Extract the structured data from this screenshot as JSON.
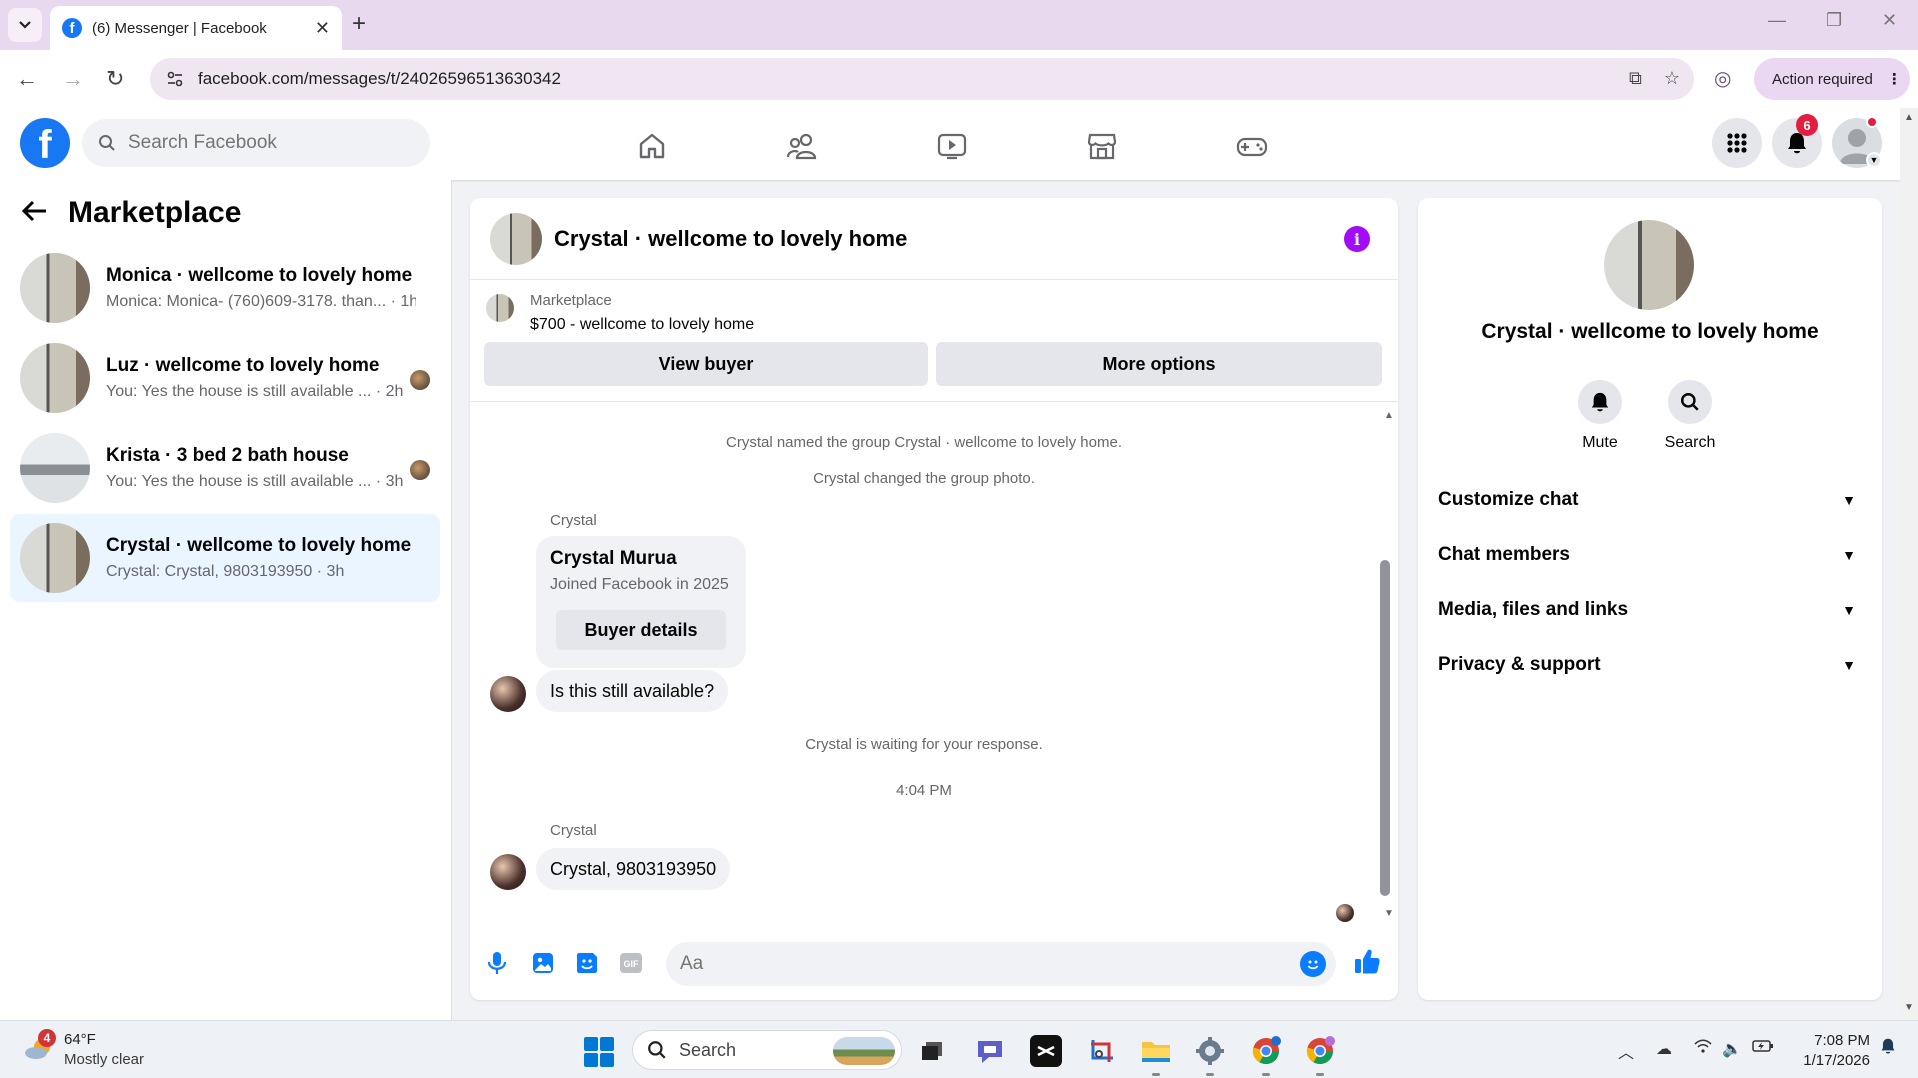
{
  "browser": {
    "tab_title": "(6) Messenger | Facebook",
    "url": "facebook.com/messages/t/24026596513630342",
    "action_required": "Action required"
  },
  "fb": {
    "search_placeholder": "Search Facebook",
    "notif_count": "6",
    "brand_color": "#1877f2"
  },
  "left": {
    "title": "Marketplace",
    "conversations": [
      {
        "name": "Monica · wellcome to lovely home",
        "preview": "Monica: Monica- (760)609-3178. than... · 1h"
      },
      {
        "name": "Luz · wellcome to lovely home",
        "preview": "You: Yes the house is still available ... · 2h"
      },
      {
        "name": "Krista · 3 bed 2 bath house",
        "preview": "You: Yes the house is still available ... · 3h"
      },
      {
        "name": "Crystal · wellcome to lovely home",
        "preview": "Crystal: Crystal, 9803193950 · 3h"
      }
    ]
  },
  "chat": {
    "title": "Crystal · wellcome to lovely home",
    "marketplace_label": "Marketplace",
    "listing": "$700 - wellcome to lovely home",
    "view_buyer": "View buyer",
    "more_options": "More options",
    "sys1": "Crystal named the group Crystal · wellcome to lovely home.",
    "sys2": "Crystal changed the group photo.",
    "sender1": "Crystal",
    "card_name": "Crystal Murua",
    "card_sub": "Joined Facebook in 2025",
    "card_button": "Buyer details",
    "msg1": "Is this still available?",
    "waiting": "Crystal is waiting for your response.",
    "time": "4:04 PM",
    "sender2": "Crystal",
    "msg2": "Crystal, 9803193950",
    "composer_placeholder": "Aa"
  },
  "right": {
    "title": "Crystal · wellcome to lovely home",
    "mute": "Mute",
    "search": "Search",
    "rows": [
      "Customize chat",
      "Chat members",
      "Media, files and links",
      "Privacy & support"
    ]
  },
  "taskbar": {
    "weather_badge": "4",
    "temp": "64°F",
    "weather": "Mostly clear",
    "search": "Search",
    "time": "7:08 PM",
    "date": "1/17/2026"
  }
}
